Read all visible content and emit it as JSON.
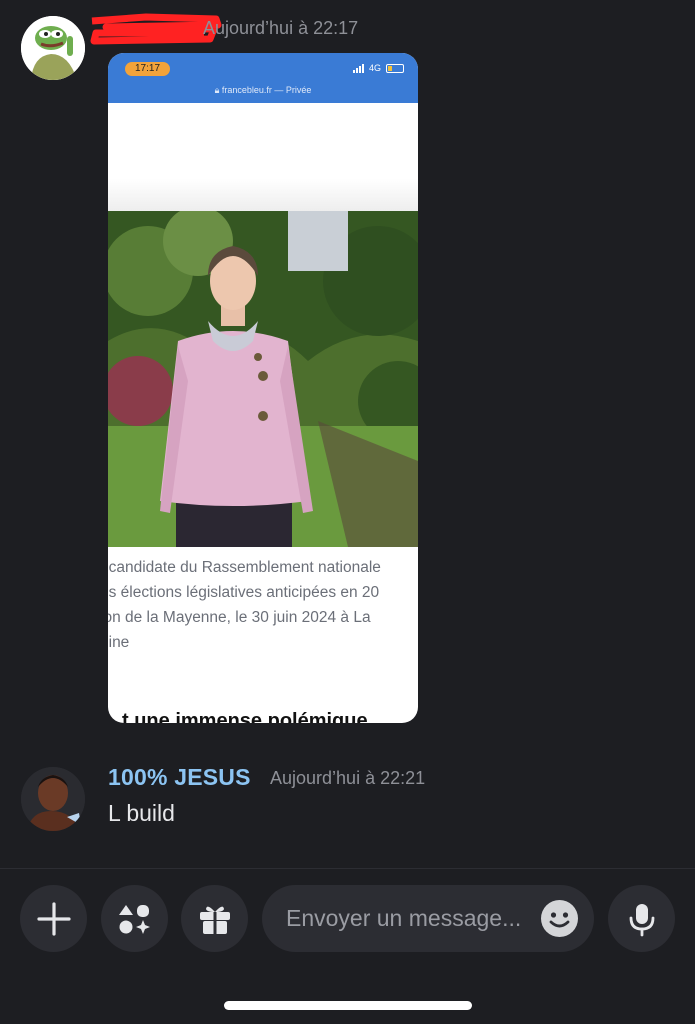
{
  "messages": [
    {
      "timestamp": "Aujourd’hui à 22:17",
      "attachment": {
        "status_time": "17:17",
        "network": "4G",
        "url_text": "francebleu.fr — Privée",
        "caption_lines": [
          ", candidate du Rassemblement nationale",
          "es élections législatives anticipées en 20",
          "ion de la Mayenne, le 30 juin 2024 à La",
          "bine"
        ],
        "headline_fragment": "t une immense polémique"
      }
    },
    {
      "username": "100% JESUS",
      "timestamp": "Aujourd’hui à 22:21",
      "text": "L build"
    }
  ],
  "composer": {
    "placeholder": "Envoyer un message..."
  },
  "icons": {
    "add": "plus-icon",
    "apps": "apps-icon",
    "gift": "gift-icon",
    "emoji": "emoji-icon",
    "mic": "microphone-icon"
  },
  "colors": {
    "background": "#1d1e22",
    "username": "#8cc4f2",
    "button": "#2c2d33",
    "browser_bar": "#3a7bd5"
  }
}
